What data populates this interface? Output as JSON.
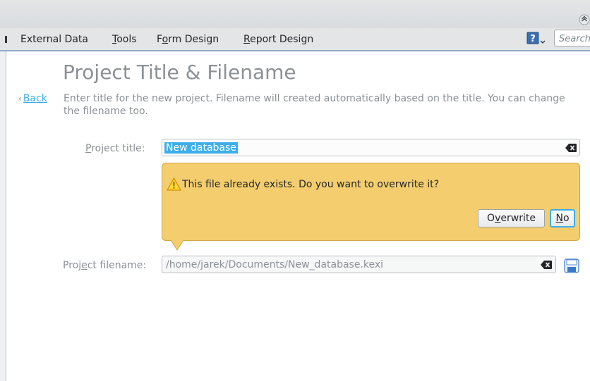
{
  "menubar": {
    "items": [
      {
        "pre": "",
        "mn": "",
        "post": "External Data"
      },
      {
        "pre": "",
        "mn": "T",
        "post": "ools"
      },
      {
        "pre": "F",
        "mn": "o",
        "post": "rm Design"
      },
      {
        "pre": "",
        "mn": "R",
        "post": "eport Design"
      }
    ],
    "help_icon": "help-question-icon",
    "search_placeholder": "Search"
  },
  "page": {
    "title": "Project Title & Filename",
    "back_chevron": "‹",
    "back_label": "Back",
    "description": "Enter title for the new project. Filename will created automatically based on the title. You can change the filename too."
  },
  "form": {
    "title_label": {
      "pre": "",
      "mn": "P",
      "post": "roject title:"
    },
    "title_value": "New database",
    "filename_label": {
      "pre": "Proj",
      "mn": "e",
      "post": "ct filename:"
    },
    "filename_value": "/home/jarek/Documents/New_database.kexi"
  },
  "warning": {
    "icon": "warning-triangle-icon",
    "message": "This file already exists. Do you want to overwrite it?",
    "overwrite_button": {
      "pre": "O",
      "mn": "v",
      "post": "erwrite"
    },
    "no_button": {
      "pre": "",
      "mn": "N",
      "post": "o"
    }
  },
  "colors": {
    "accent": "#3daee9",
    "warning_bg": "#f3cd6e",
    "warning_border": "#d2a640",
    "muted_text": "#8b9196"
  }
}
